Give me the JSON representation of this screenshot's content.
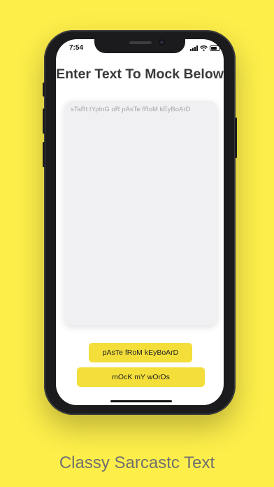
{
  "status_bar": {
    "time": "7:54"
  },
  "screen": {
    "title": "Enter Text To Mock Below",
    "input": {
      "value": "",
      "placeholder": "sTaRt tYpInG oR pAsTe fRoM kEyBoArD"
    },
    "buttons": {
      "paste_label": "pAsTe fRoM kEyBoArD",
      "mock_label": "mOcK mY wOrDs"
    }
  },
  "caption": "Classy Sarcastc Text",
  "colors": {
    "background": "#FDEE4A",
    "button": "#F3DE3A",
    "phone_frame": "#1b1b1d"
  }
}
